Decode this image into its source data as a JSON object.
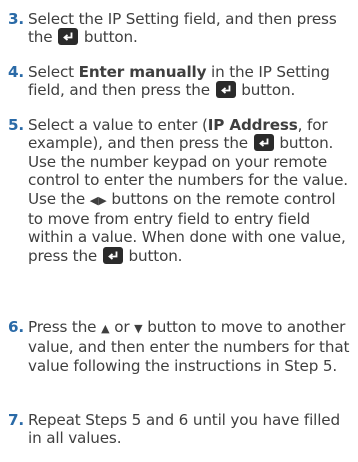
{
  "steps": [
    {
      "number": "3.",
      "text_a": "Select the IP Setting field, and then press the ",
      "text_b": " button."
    },
    {
      "number": "4.",
      "text_a": "Select ",
      "bold_a": "Enter manually",
      "text_b": " in the IP Setting field, and then press the ",
      "text_c": " button."
    },
    {
      "number": "5.",
      "text_a": "Select a value to enter (",
      "bold_a": "IP Address",
      "text_b": ", for example), and then press the ",
      "text_c": " button.",
      "para2_a": "Use the number keypad on your remote control to enter the numbers for the value. Use the ",
      "para2_arrows": "◀▶",
      "para2_b": " buttons on the remote control to move from entry field to entry field within a value. When done with one value, press the ",
      "para2_c": " button."
    },
    {
      "number": "6.",
      "text_a": "Press the ",
      "arrow_up": "▲",
      "text_b": " or ",
      "arrow_down": "▼",
      "text_c": " button to move to another value, and then enter the numbers for that value following the instructions in Step 5."
    },
    {
      "number": "7.",
      "text_a": "Repeat Steps 5 and 6 until you have filled in all values."
    }
  ],
  "icons": {
    "enter": "enter-button-icon"
  },
  "colors": {
    "step_number": "#2a6aa7",
    "text": "#3f3f3f",
    "icon_bg": "#2b2b2b"
  }
}
